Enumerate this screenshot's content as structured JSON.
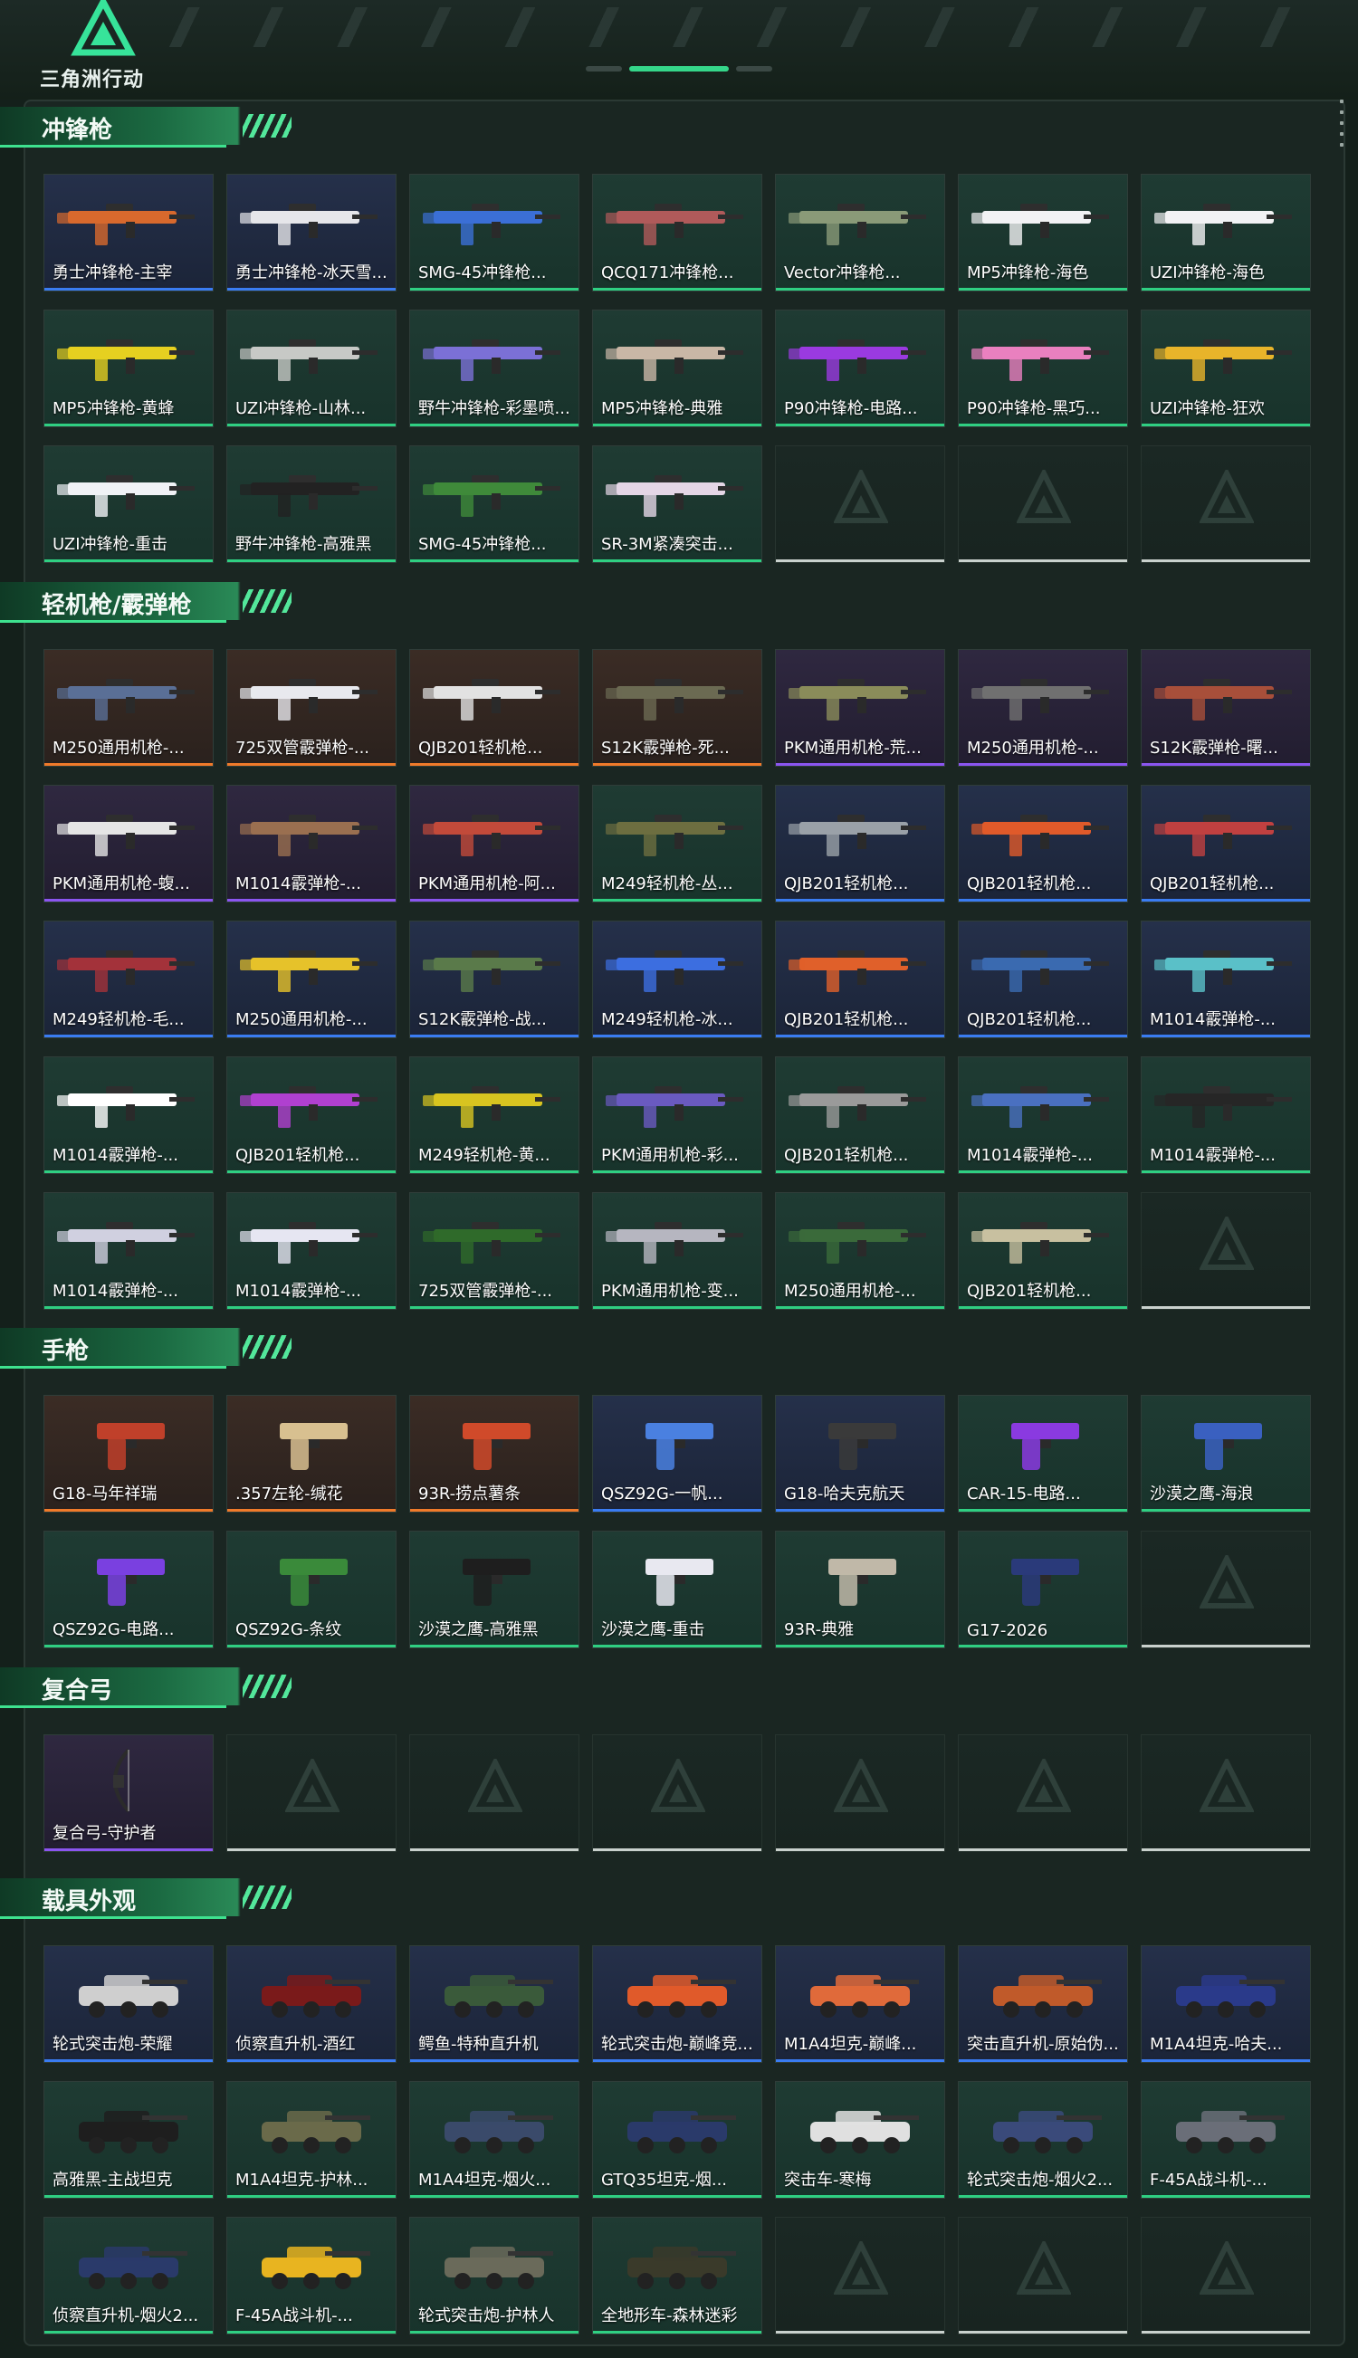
{
  "app": {
    "logo_text": "三角洲行动"
  },
  "sections": [
    {
      "title": "冲锋枪",
      "cards": [
        {
          "label": "勇士冲锋枪-主宰",
          "rarity": "blue",
          "color": "#d8692d"
        },
        {
          "label": "勇士冲锋枪-冰天雪...",
          "rarity": "blue",
          "color": "#e6e6ea"
        },
        {
          "label": "SMG-45冲锋枪...",
          "rarity": "green",
          "color": "#3b6fd6"
        },
        {
          "label": "QCQ171冲锋枪...",
          "rarity": "green",
          "color": "#b05a5a"
        },
        {
          "label": "Vector冲锋枪...",
          "rarity": "green",
          "color": "#8a9a78"
        },
        {
          "label": "MP5冲锋枪-海色",
          "rarity": "green",
          "color": "#f2f2f4"
        },
        {
          "label": "UZI冲锋枪-海色",
          "rarity": "green",
          "color": "#f2f2f4"
        },
        {
          "label": "MP5冲锋枪-黄蜂",
          "rarity": "green",
          "color": "#e6d020"
        },
        {
          "label": "UZI冲锋枪-山林...",
          "rarity": "green",
          "color": "#c7c9c6"
        },
        {
          "label": "野牛冲锋枪-彩墨喷...",
          "rarity": "green",
          "color": "#7b70d6"
        },
        {
          "label": "MP5冲锋枪-典雅",
          "rarity": "green",
          "color": "#c9b7a6"
        },
        {
          "label": "P90冲锋枪-电路...",
          "rarity": "green",
          "color": "#9a3ae0"
        },
        {
          "label": "P90冲锋枪-黑巧...",
          "rarity": "green",
          "color": "#e980bf"
        },
        {
          "label": "UZI冲锋枪-狂欢",
          "rarity": "green",
          "color": "#e8b42a"
        },
        {
          "label": "UZI冲锋枪-重击",
          "rarity": "green",
          "color": "#f0f2f6"
        },
        {
          "label": "野牛冲锋枪-高雅黑",
          "rarity": "green",
          "color": "#222222"
        },
        {
          "label": "SMG-45冲锋枪...",
          "rarity": "green",
          "color": "#3f8a3a"
        },
        {
          "label": "SR-3M紧凑突击...",
          "rarity": "green",
          "color": "#e4d6e6"
        },
        {
          "empty": true
        },
        {
          "empty": true
        },
        {
          "empty": true
        }
      ]
    },
    {
      "title": "轻机枪/霰弹枪",
      "cards": [
        {
          "label": "M250通用机枪-...",
          "rarity": "orange",
          "color": "#5a6f96"
        },
        {
          "label": "725双管霰弹枪-...",
          "rarity": "orange",
          "color": "#e8e9ee"
        },
        {
          "label": "QJB201轻机枪...",
          "rarity": "orange",
          "color": "#e2e2e2"
        },
        {
          "label": "S12K霰弹枪-死...",
          "rarity": "orange",
          "color": "#6b6a52"
        },
        {
          "label": "PKM通用机枪-荒...",
          "rarity": "purple",
          "color": "#8a8c5a"
        },
        {
          "label": "M250通用机枪-...",
          "rarity": "purple",
          "color": "#707070"
        },
        {
          "label": "S12K霰弹枪-曙...",
          "rarity": "purple",
          "color": "#a84f3a"
        },
        {
          "label": "PKM通用机枪-蝮...",
          "rarity": "purple",
          "color": "#e5e5e5"
        },
        {
          "label": "M1014霰弹枪-...",
          "rarity": "purple",
          "color": "#9a6f50"
        },
        {
          "label": "PKM通用机枪-阿...",
          "rarity": "purple",
          "color": "#c24a3a"
        },
        {
          "label": "M249轻机枪-丛...",
          "rarity": "green",
          "color": "#6d6e40"
        },
        {
          "label": "QJB201轻机枪...",
          "rarity": "blue",
          "color": "#9aa1a8"
        },
        {
          "label": "QJB201轻机枪...",
          "rarity": "blue",
          "color": "#e05a2a"
        },
        {
          "label": "QJB201轻机枪...",
          "rarity": "blue",
          "color": "#c04040"
        },
        {
          "label": "M249轻机枪-毛...",
          "rarity": "blue",
          "color": "#a3323a"
        },
        {
          "label": "M250通用机枪-...",
          "rarity": "blue",
          "color": "#e6c22a"
        },
        {
          "label": "S12K霰弹枪-战...",
          "rarity": "blue",
          "color": "#5a7a4a"
        },
        {
          "label": "M249轻机枪-冰...",
          "rarity": "blue",
          "color": "#3c6ee0"
        },
        {
          "label": "QJB201轻机枪...",
          "rarity": "blue",
          "color": "#e0602a"
        },
        {
          "label": "QJB201轻机枪...",
          "rarity": "blue",
          "color": "#3a6ab0"
        },
        {
          "label": "M1014霰弹枪-...",
          "rarity": "blue",
          "color": "#5ac0c8"
        },
        {
          "label": "M1014霰弹枪-...",
          "rarity": "green",
          "color": "#ffffff"
        },
        {
          "label": "QJB201轻机枪...",
          "rarity": "green",
          "color": "#b040d0"
        },
        {
          "label": "M249轻机枪-黄...",
          "rarity": "green",
          "color": "#d8c420"
        },
        {
          "label": "PKM通用机枪-彩...",
          "rarity": "green",
          "color": "#6a5ac0"
        },
        {
          "label": "QJB201轻机枪...",
          "rarity": "green",
          "color": "#9a9a9a"
        },
        {
          "label": "M1014霰弹枪-...",
          "rarity": "green",
          "color": "#4a70c0"
        },
        {
          "label": "M1014霰弹枪-...",
          "rarity": "green",
          "color": "#262626"
        },
        {
          "label": "M1014霰弹枪-...",
          "rarity": "green",
          "color": "#d0d0e0"
        },
        {
          "label": "M1014霰弹枪-...",
          "rarity": "green",
          "color": "#e6e6f2"
        },
        {
          "label": "725双管霰弹枪-...",
          "rarity": "green",
          "color": "#2f6a2a"
        },
        {
          "label": "PKM通用机枪-变...",
          "rarity": "green",
          "color": "#b6b6c0"
        },
        {
          "label": "M250通用机枪-...",
          "rarity": "green",
          "color": "#3a6a3a"
        },
        {
          "label": "QJB201轻机枪...",
          "rarity": "green",
          "color": "#c8c0a0"
        },
        {
          "empty": true
        }
      ]
    },
    {
      "title": "手枪",
      "cards": [
        {
          "label": "G18-马年祥瑞",
          "rarity": "orange",
          "color": "#c0402a"
        },
        {
          "label": ".357左轮-缄花",
          "rarity": "orange",
          "color": "#d8c090"
        },
        {
          "label": "93R-捞点薯条",
          "rarity": "orange",
          "color": "#d04a2a"
        },
        {
          "label": "QSZ92G-一帆...",
          "rarity": "blue",
          "color": "#4a80e0"
        },
        {
          "label": "G18-哈夫克航天",
          "rarity": "blue",
          "color": "#3a3a3a"
        },
        {
          "label": "CAR-15-电路...",
          "rarity": "green",
          "color": "#8a3ae0"
        },
        {
          "label": "沙漠之鹰-海浪",
          "rarity": "green",
          "color": "#3a60c0"
        },
        {
          "label": "QSZ92G-电路...",
          "rarity": "green",
          "color": "#7a40e0"
        },
        {
          "label": "QSZ92G-条纹",
          "rarity": "green",
          "color": "#3a8a3a"
        },
        {
          "label": "沙漠之鹰-高雅黑",
          "rarity": "green",
          "color": "#1e1e1e"
        },
        {
          "label": "沙漠之鹰-重击",
          "rarity": "green",
          "color": "#e8e8f0"
        },
        {
          "label": "93R-典雅",
          "rarity": "green",
          "color": "#c0b8a8"
        },
        {
          "label": "G17-2026",
          "rarity": "green",
          "color": "#2a3a7a"
        },
        {
          "empty": true
        }
      ]
    },
    {
      "title": "复合弓",
      "cards": [
        {
          "label": "复合弓-守护者",
          "rarity": "purple",
          "color": "#2a2a2a"
        },
        {
          "empty": true
        },
        {
          "empty": true
        },
        {
          "empty": true
        },
        {
          "empty": true
        },
        {
          "empty": true
        },
        {
          "empty": true
        }
      ]
    },
    {
      "title": "载具外观",
      "cards": [
        {
          "label": "轮式突击炮-荣耀",
          "rarity": "blue",
          "color": "#cfcfcf"
        },
        {
          "label": "侦察直升机-酒红",
          "rarity": "blue",
          "color": "#7a1a1a"
        },
        {
          "label": "鳄鱼-特种直升机",
          "rarity": "blue",
          "color": "#3a5a3a"
        },
        {
          "label": "轮式突击炮-巅峰竞...",
          "rarity": "blue",
          "color": "#e05a2a"
        },
        {
          "label": "M1A4坦克-巅峰...",
          "rarity": "blue",
          "color": "#e06a3a"
        },
        {
          "label": "突击直升机-原始伪...",
          "rarity": "blue",
          "color": "#c05a2a"
        },
        {
          "label": "M1A4坦克-哈夫...",
          "rarity": "blue",
          "color": "#2a3a8a"
        },
        {
          "label": "高雅黑-主战坦克",
          "rarity": "green",
          "color": "#1e1e1e"
        },
        {
          "label": "M1A4坦克-护林...",
          "rarity": "green",
          "color": "#6a6a4a"
        },
        {
          "label": "M1A4坦克-烟火...",
          "rarity": "green",
          "color": "#3a4a6a"
        },
        {
          "label": "GTQ35坦克-烟...",
          "rarity": "green",
          "color": "#2a3a6a"
        },
        {
          "label": "突击车-寒梅",
          "rarity": "green",
          "color": "#e0e0e0"
        },
        {
          "label": "轮式突击炮-烟火2...",
          "rarity": "green",
          "color": "#3a4a7a"
        },
        {
          "label": "F-45A战斗机-...",
          "rarity": "green",
          "color": "#6a6e78"
        },
        {
          "label": "侦察直升机-烟火2...",
          "rarity": "green",
          "color": "#2a3a6a"
        },
        {
          "label": "F-45A战斗机-...",
          "rarity": "green",
          "color": "#e8b420"
        },
        {
          "label": "轮式突击炮-护林人",
          "rarity": "green",
          "color": "#6a6a5a"
        },
        {
          "label": "全地形车-森林迷彩",
          "rarity": "green",
          "color": "#3a3a2a"
        },
        {
          "empty": true
        },
        {
          "empty": true
        },
        {
          "empty": true
        }
      ]
    }
  ]
}
